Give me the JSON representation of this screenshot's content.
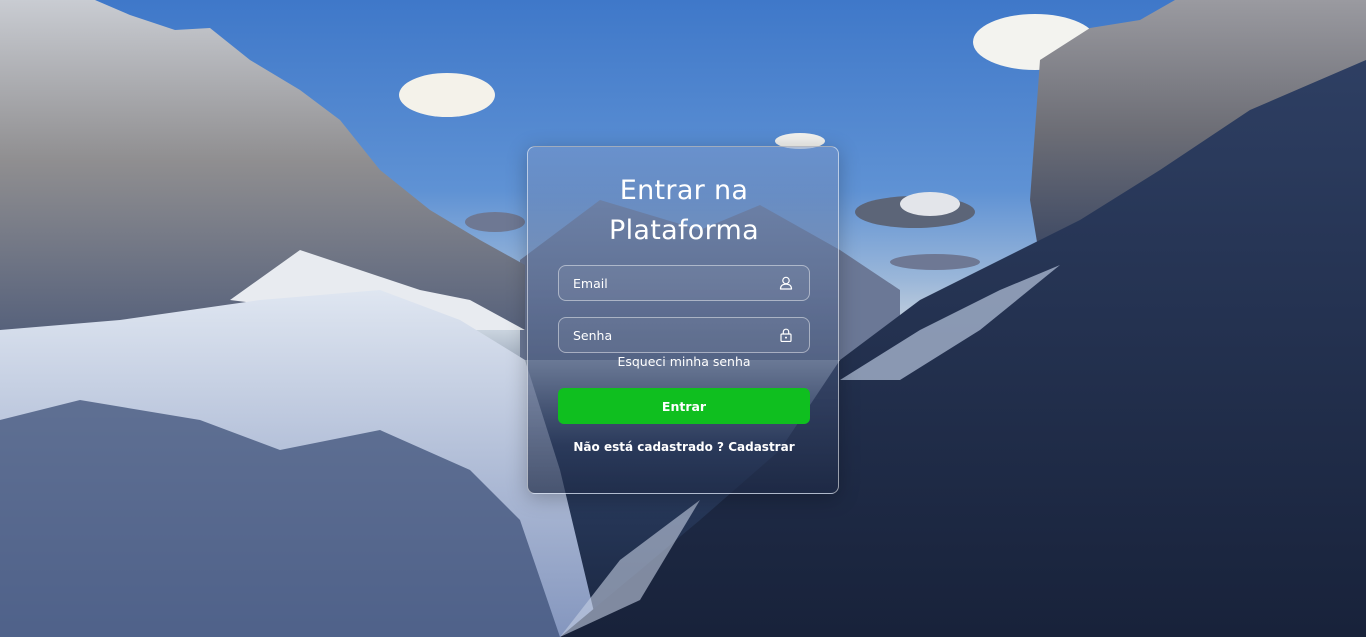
{
  "login": {
    "title_line1": "Entrar na",
    "title_line2": "Plataforma",
    "email_placeholder": "Email",
    "password_placeholder": "Senha",
    "forgot_password": "Esqueci minha senha",
    "submit_label": "Entrar",
    "register_prompt": "Não está cadastrado ?",
    "register_link": "Cadastrar"
  },
  "icons": {
    "email_field_icon": "user-icon",
    "password_field_icon": "lock-icon"
  },
  "colors": {
    "primary_button": "#0fbf1f",
    "text": "#ffffff"
  }
}
